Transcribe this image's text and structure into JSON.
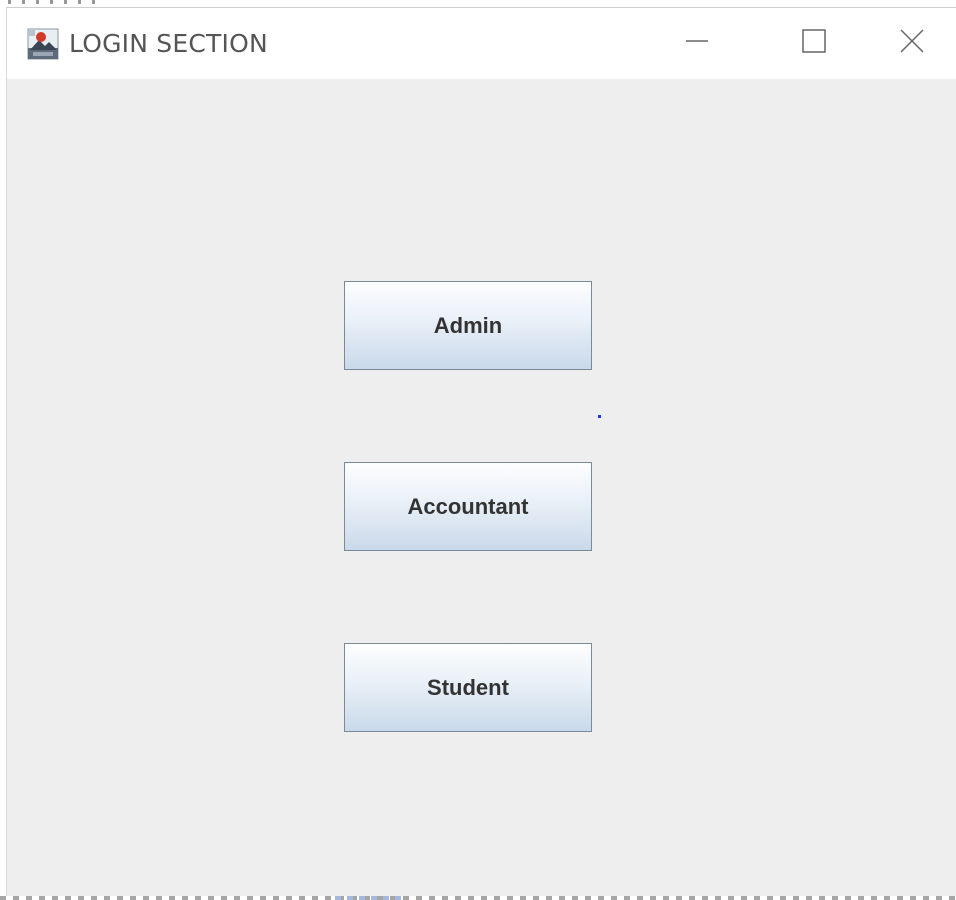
{
  "window": {
    "title": "LOGIN SECTION",
    "app_icon": "java-app-icon",
    "controls": {
      "minimize_icon": "minimize-icon",
      "maximize_icon": "maximize-icon",
      "close_icon": "close-icon"
    }
  },
  "buttons": {
    "admin_label": "Admin",
    "accountant_label": "Accountant",
    "student_label": "Student"
  },
  "colors": {
    "window_background": "#eeeeee",
    "titlebar_background": "#ffffff",
    "title_text": "#555555",
    "button_text": "#333333",
    "button_gradient_top": "#fdfeff",
    "button_gradient_bottom": "#c9d9ea",
    "button_border": "#7a8a99"
  }
}
